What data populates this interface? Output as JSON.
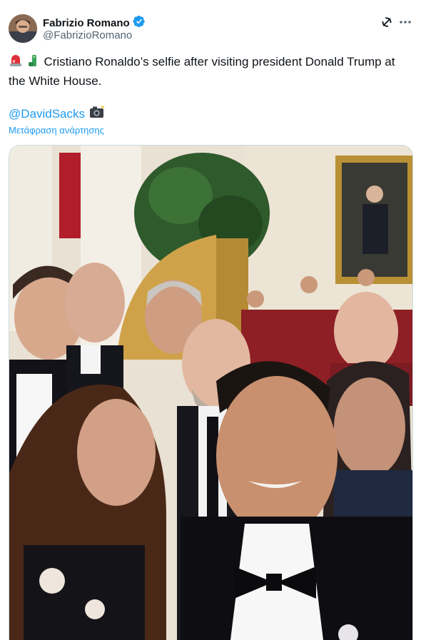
{
  "author": {
    "display_name": "Fabrizio Romano",
    "handle": "@FabrizioRomano",
    "verified_icon": "verified-badge-icon"
  },
  "tweet": {
    "text": "Cristiano Ronaldo’s selfie after visiting president Donald Trump at the White House.",
    "leading_emojis": [
      "rotating-light-emoji",
      "phone-emoji"
    ],
    "mention": "@DavidSacks",
    "mention_emoji": "camera-flash-emoji",
    "translate_label": "Μετάφραση ανάρτησης"
  },
  "icons": {
    "grok": "grok-icon",
    "more": "more-options-icon"
  },
  "colors": {
    "link": "#1d9bf0",
    "text": "#0f1419",
    "secondary": "#536471",
    "verified": "#1d9bf0"
  }
}
